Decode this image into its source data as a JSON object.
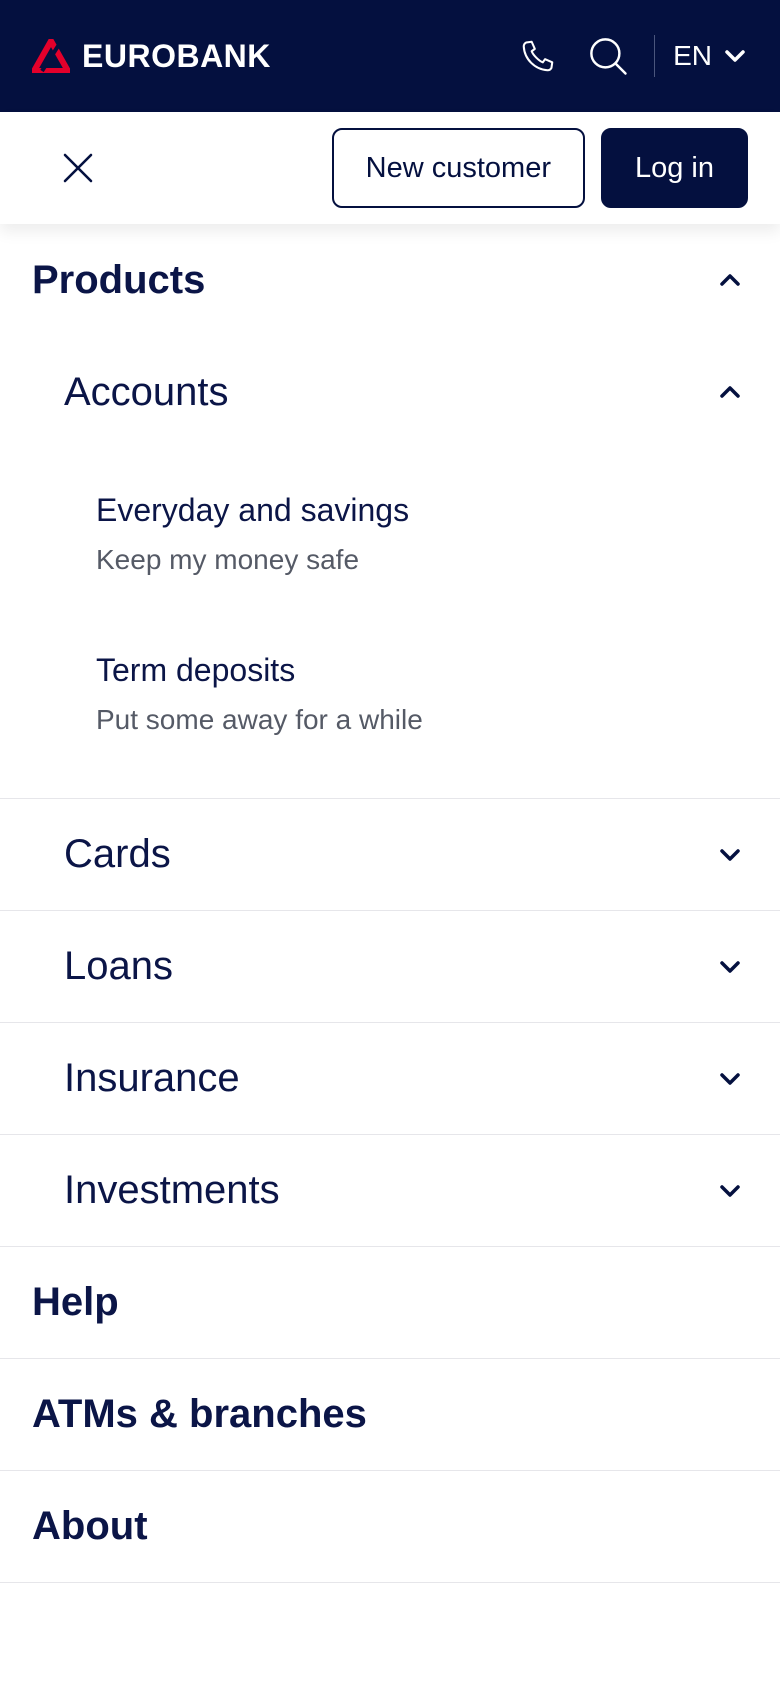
{
  "header": {
    "brand_name": "EUROBANK",
    "language": "EN",
    "colors": {
      "navy": "#04103f",
      "brand_red": "#e4002b"
    },
    "icons": [
      "eurobank-logo-icon",
      "phone-icon",
      "search-icon",
      "chevron-down-icon"
    ]
  },
  "actions": {
    "new_customer": "New customer",
    "log_in": "Log in"
  },
  "menu": {
    "products": "Products",
    "accounts": {
      "label": "Accounts",
      "items": [
        {
          "title": "Everyday and savings",
          "desc": "Keep my money safe"
        },
        {
          "title": "Term deposits",
          "desc": "Put some away for a while"
        }
      ]
    },
    "cards": "Cards",
    "loans": "Loans",
    "insurance": "Insurance",
    "investments": "Investments",
    "help": "Help",
    "atms": "ATMs & branches",
    "about": "About"
  }
}
